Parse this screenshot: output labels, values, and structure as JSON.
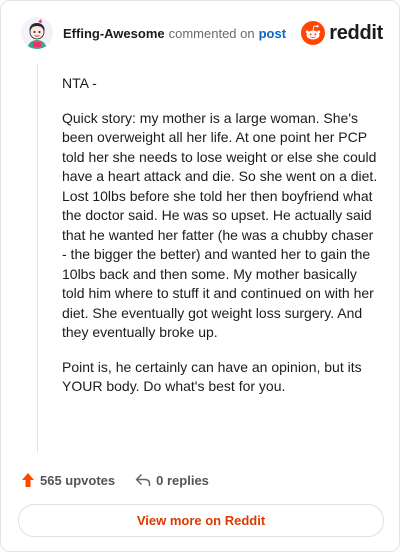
{
  "header": {
    "username": "Effing-Awesome",
    "action_text": "commented on",
    "post_link": "post",
    "brand": "reddit",
    "brand_color": "#ff4500"
  },
  "comment": {
    "paragraphs": [
      "NTA -",
      "Quick story: my mother is a large woman. She's been overweight all her life. At one point her PCP told her she needs to lose weight or else she could have a heart attack and die. So she went on a diet. Lost 10lbs before she told her then boyfriend what the doctor said. He was so upset. He actually said that he wanted her fatter (he was a chubby chaser - the bigger the better) and wanted her to gain the 10lbs back and then some. My mother basically told him where to stuff it and continued on with her diet. She eventually got weight loss surgery. And they eventually broke up.",
      "Point is, he certainly can have an opinion, but its YOUR body. Do what's best for you."
    ]
  },
  "actions": {
    "upvotes": "565 upvotes",
    "replies": "0 replies"
  },
  "footer": {
    "view_more": "View more on Reddit"
  }
}
